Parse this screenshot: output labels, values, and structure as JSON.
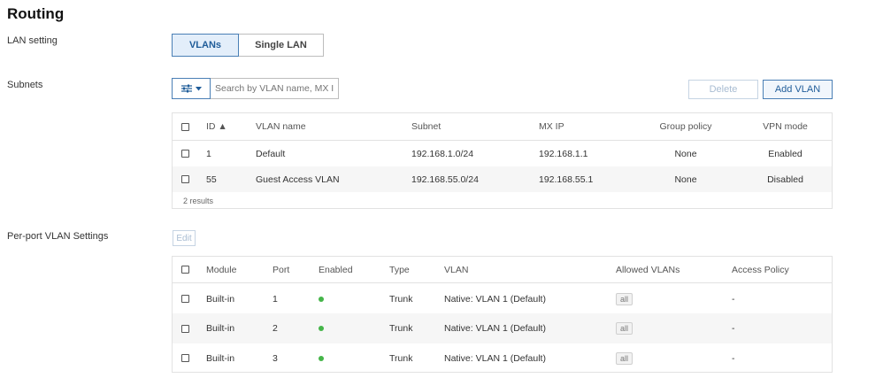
{
  "page_title": "Routing",
  "lan_setting": {
    "label": "LAN setting",
    "options": [
      "VLANs",
      "Single LAN"
    ],
    "selected": "VLANs"
  },
  "subnets": {
    "label": "Subnets",
    "search_placeholder": "Search by VLAN name, MX IP",
    "delete_label": "Delete",
    "add_label": "Add VLAN",
    "columns": [
      "ID ▲",
      "VLAN name",
      "Subnet",
      "MX IP",
      "Group policy",
      "VPN mode"
    ],
    "rows": [
      {
        "id": "1",
        "name": "Default",
        "subnet": "192.168.1.0/24",
        "mx_ip": "192.168.1.1",
        "group_policy": "None",
        "vpn_mode": "Enabled"
      },
      {
        "id": "55",
        "name": "Guest Access VLAN",
        "subnet": "192.168.55.0/24",
        "mx_ip": "192.168.55.1",
        "group_policy": "None",
        "vpn_mode": "Disabled"
      }
    ],
    "result_count": "2 results"
  },
  "per_port": {
    "label": "Per-port VLAN Settings",
    "edit_label": "Edit",
    "columns": [
      "Module",
      "Port",
      "Enabled",
      "Type",
      "VLAN",
      "Allowed VLANs",
      "Access Policy"
    ],
    "rows": [
      {
        "module": "Built-in",
        "port": "1",
        "type": "Trunk",
        "vlan": "Native: VLAN 1 (Default)",
        "allowed": "all",
        "access_policy": "-"
      },
      {
        "module": "Built-in",
        "port": "2",
        "type": "Trunk",
        "vlan": "Native: VLAN 1 (Default)",
        "allowed": "all",
        "access_policy": "-"
      },
      {
        "module": "Built-in",
        "port": "3",
        "type": "Trunk",
        "vlan": "Native: VLAN 1 (Default)",
        "allowed": "all",
        "access_policy": "-"
      }
    ]
  },
  "colors": {
    "accent": "#4a7fb5",
    "enabled_dot": "#45b549"
  }
}
